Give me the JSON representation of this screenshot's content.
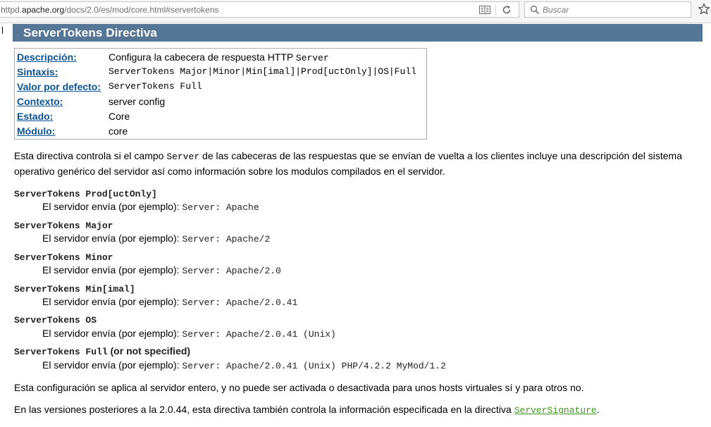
{
  "browser": {
    "url_prefix": "httpd.",
    "url_host": "apache.org",
    "url_path": "/docs/2.0/es/mod/core.html#servertokens",
    "search_placeholder": "Buscar"
  },
  "header": {
    "title": "ServerTokens Directiva"
  },
  "directive_table": [
    {
      "key": "Descripción:",
      "value": "Configura la cabecera de respuesta HTTP ",
      "code": "Server"
    },
    {
      "key": "Sintaxis:",
      "value": "",
      "code": "ServerTokens Major|Minor|Min[imal]|Prod[uctOnly]|OS|Full"
    },
    {
      "key": "Valor por defecto:",
      "value": "",
      "code": "ServerTokens Full"
    },
    {
      "key": "Contexto:",
      "value": "server config",
      "code": ""
    },
    {
      "key": "Estado:",
      "value": "Core",
      "code": ""
    },
    {
      "key": "Módulo:",
      "value": "core",
      "code": ""
    }
  ],
  "intro": {
    "part1": "Esta directiva controla si el campo ",
    "code": "Server",
    "part2": " de las cabeceras de las respuestas que se envían de vuelta a los clientes incluye una descripción del sistema operativo genérico del servidor así como información sobre los modulos compilados en el servidor."
  },
  "options": [
    {
      "name": "ServerTokens Prod[uctOnly]",
      "suffix": "",
      "desc": "El servidor envía (por ejemplo): ",
      "example": "Server: Apache"
    },
    {
      "name": "ServerTokens Major",
      "suffix": "",
      "desc": "El servidor envía (por ejemplo): ",
      "example": "Server: Apache/2"
    },
    {
      "name": "ServerTokens Minor",
      "suffix": "",
      "desc": "El servidor envía (por ejemplo): ",
      "example": "Server: Apache/2.0"
    },
    {
      "name": "ServerTokens Min[imal]",
      "suffix": "",
      "desc": "El servidor envía (por ejemplo): ",
      "example": "Server: Apache/2.0.41"
    },
    {
      "name": "ServerTokens OS",
      "suffix": "",
      "desc": "El servidor envía (por ejemplo): ",
      "example": "Server: Apache/2.0.41 (Unix)"
    },
    {
      "name": "ServerTokens Full",
      "suffix": " (or not specified)",
      "desc": "El servidor envía (por ejemplo): ",
      "example": "Server: Apache/2.0.41 (Unix) PHP/4.2.2 MyMod/1.2"
    }
  ],
  "note1": "Esta configuración se aplica al servidor entero, y no puede ser activada o desactivada para unos hosts virtuales sí y para otros no.",
  "note2": {
    "text": "En las versiones posteriores a la 2.0.44, esta directiva también controla la información especificada en la directiva ",
    "link": "ServerSignature",
    "end": "."
  },
  "colors": {
    "header_bg": "#557697",
    "link": "#0b5394",
    "code_link": "#3a9a1a"
  }
}
